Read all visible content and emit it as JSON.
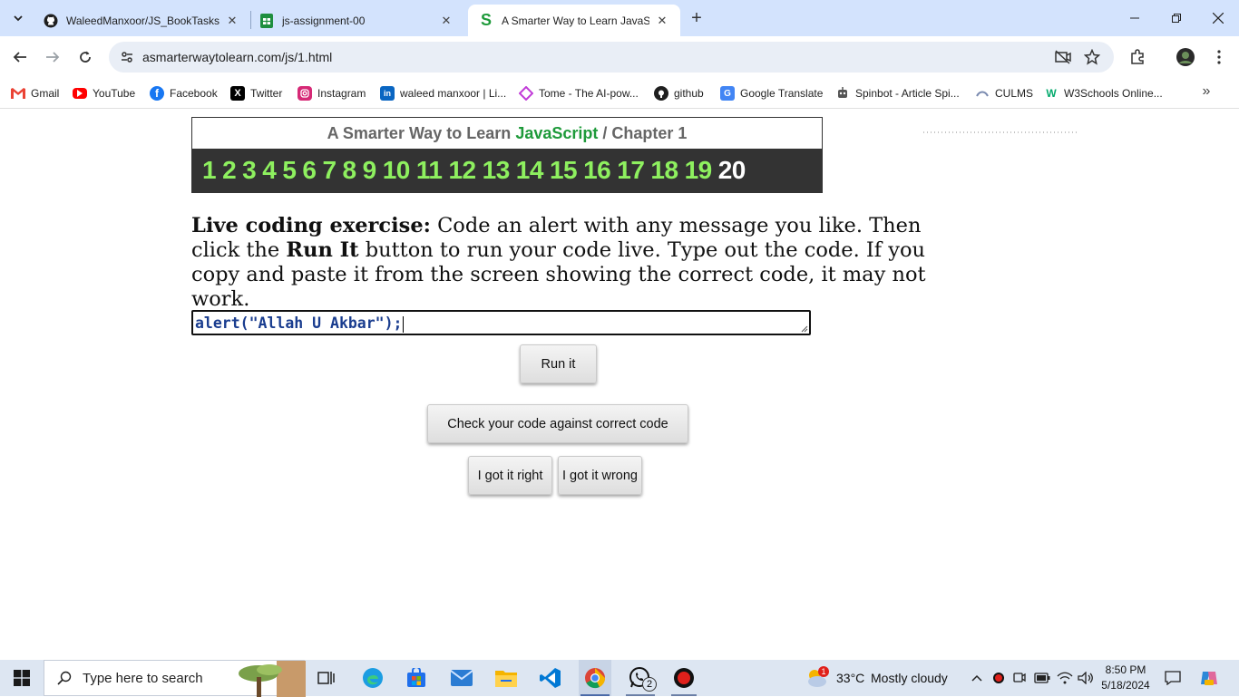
{
  "tabs": [
    {
      "title": "WaleedManxoor/JS_BookTasks",
      "icon": "github-icon"
    },
    {
      "title": "js-assignment-00",
      "icon": "google-sheets-icon"
    },
    {
      "title": "A Smarter Way to Learn JavaScr",
      "icon": "smarter-way-s-icon"
    }
  ],
  "toolbar": {
    "url": "asmarterwaytolearn.com/js/1.html"
  },
  "bookmarks": [
    {
      "label": "Gmail",
      "icon": "gmail-icon",
      "color": "#ea4335"
    },
    {
      "label": "YouTube",
      "icon": "youtube-icon",
      "color": "#ff0000"
    },
    {
      "label": "Facebook",
      "icon": "facebook-icon",
      "color": "#1877f2"
    },
    {
      "label": "Twitter",
      "icon": "x-icon",
      "color": "#000000"
    },
    {
      "label": "Instagram",
      "icon": "instagram-icon",
      "color": "#d62976"
    },
    {
      "label": "waleed manxoor | Li...",
      "icon": "linkedin-icon",
      "color": "#0a66c2"
    },
    {
      "label": "Tome - The AI-pow...",
      "icon": "tome-icon",
      "color": "#c13cd8"
    },
    {
      "label": "github",
      "icon": "github-icon",
      "color": "#1f1f1f"
    },
    {
      "label": "Google Translate",
      "icon": "google-translate-icon",
      "color": "#4285f4"
    },
    {
      "label": "Spinbot - Article Spi...",
      "icon": "spinbot-icon",
      "color": "#555555"
    },
    {
      "label": "CULMS",
      "icon": "culms-icon",
      "color": "#7b8bb0"
    },
    {
      "label": "W3Schools Online...",
      "icon": "w3schools-icon",
      "color": "#04aa6d"
    }
  ],
  "page": {
    "header_prefix": "A Smarter Way to Learn ",
    "header_js": "JavaScript",
    "header_sep": " / ",
    "header_chapter": "Chapter 1",
    "chapters": [
      "1",
      "2",
      "3",
      "4",
      "5",
      "6",
      "7",
      "8",
      "9",
      "10",
      "11",
      "12",
      "13",
      "14",
      "15",
      "16",
      "17",
      "18",
      "19",
      "20"
    ],
    "current_chapter": "20",
    "instr_bold1": "Live coding exercise:",
    "instr_text1": " Code an alert with any message you like. Then click the ",
    "instr_bold2": "Run It",
    "instr_text2": " button to run your code live. Type out the code. If you copy and paste it from the screen showing the correct code, it may not work.",
    "code_value": "alert(\"Allah U Akbar\");",
    "run_label": "Run it",
    "check_label": "Check your code against correct code",
    "right_label": "I got it right",
    "wrong_label": "I got it wrong"
  },
  "taskbar": {
    "search_placeholder": "Type here to search",
    "whatsapp_badge": "2",
    "weather_temp": "33°C",
    "weather_desc": "Mostly cloudy",
    "weather_badge": "1",
    "time": "8:50 PM",
    "date": "5/18/2024"
  },
  "colors": {
    "accent_green": "#8ef05f",
    "js_green": "#1e9a3a",
    "tabstrip": "#d3e3fd"
  }
}
